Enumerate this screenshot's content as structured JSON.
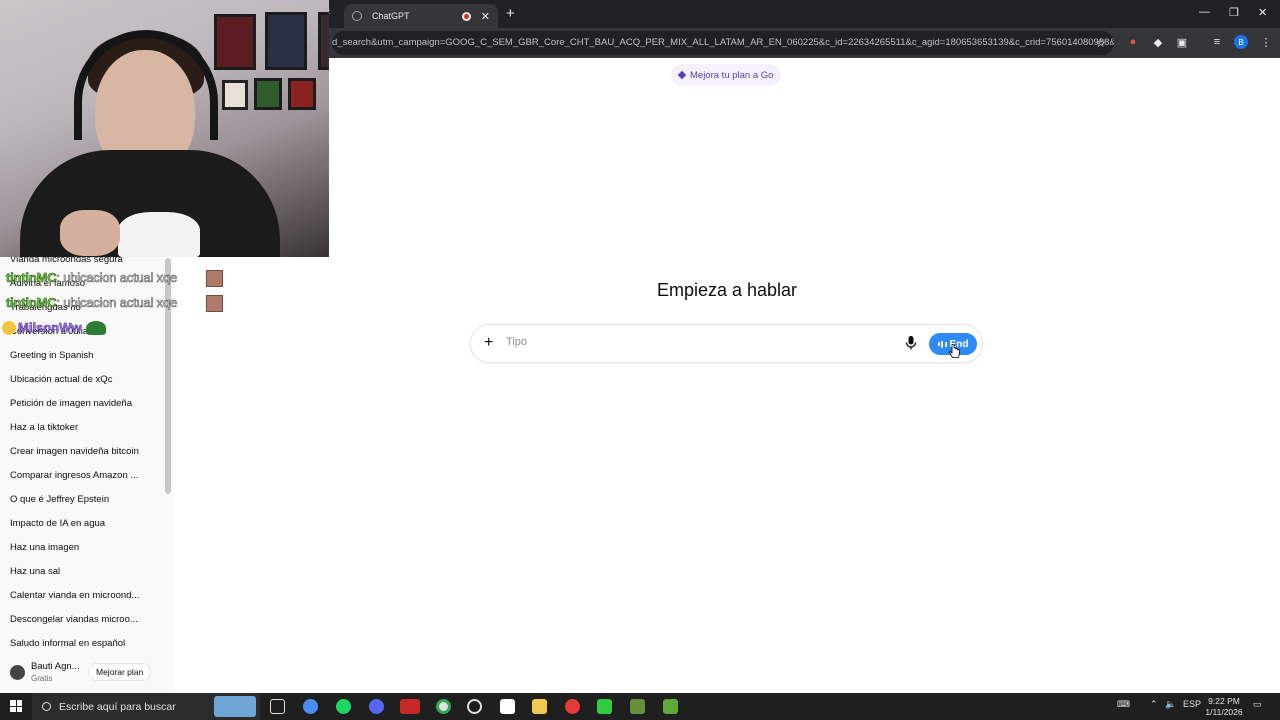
{
  "browser": {
    "tab_title": "ChatGPT",
    "url": "d_search&utm_campaign=GOOG_C_SEM_GBR_Core_CHT_BAU_ACQ_PER_MIX_ALL_LATAM_AR_EN_060225&c_id=22634265511&c_agid=180653653139&c_crid=756014080988&c_kwi...",
    "profile_initial": "B"
  },
  "promo": {
    "label": "Mejora tu plan a Go"
  },
  "main": {
    "headline": "Empieza a hablar",
    "input_placeholder": "Tipo",
    "end_label": "End"
  },
  "sidebar": {
    "items": [
      "Vianda microondas segura",
      "Adivina el famoso",
      "Trabalenguas no",
      "Conversion a Julia sf",
      "Greeting in Spanish",
      "Ubicación actual de xQc",
      "Petición de imagen navideña",
      "Haz a la tiktoker",
      "Crear imagen navideña bitcoin",
      "Comparar ingresos Amazon ...",
      "O que é Jeffrey Epstein",
      "Impacto de IA en agua",
      "Haz una imagen",
      "Haz una sal",
      "Calentar vianda en microond...",
      "Descongelar viandas microo...",
      "Saludo informal en español"
    ],
    "user_name": "Bauti Agn...",
    "user_plan": "Gratis",
    "upgrade_label": "Mejorar plan"
  },
  "stream_chat": [
    {
      "nick": "tintinMC",
      "message": ": ubicacion actual xqe"
    },
    {
      "nick": "tintinMC",
      "message": ": ubicacion actual xqe"
    },
    {
      "nick": "MilsonWw",
      "message": ""
    }
  ],
  "taskbar": {
    "search_placeholder": "Escribe aquí para buscar",
    "lang": "ESP",
    "time": "9:22 PM",
    "date": "1/11/2026"
  },
  "colors": {
    "accent_blue": "#2f8af5",
    "promo_purple": "#5b3fb0",
    "chat_nick_green": "#7bd84a"
  },
  "icons": [
    "plus-icon",
    "microphone-icon",
    "voice-bars-icon",
    "star-icon",
    "windows-start-icon",
    "search-icon"
  ]
}
